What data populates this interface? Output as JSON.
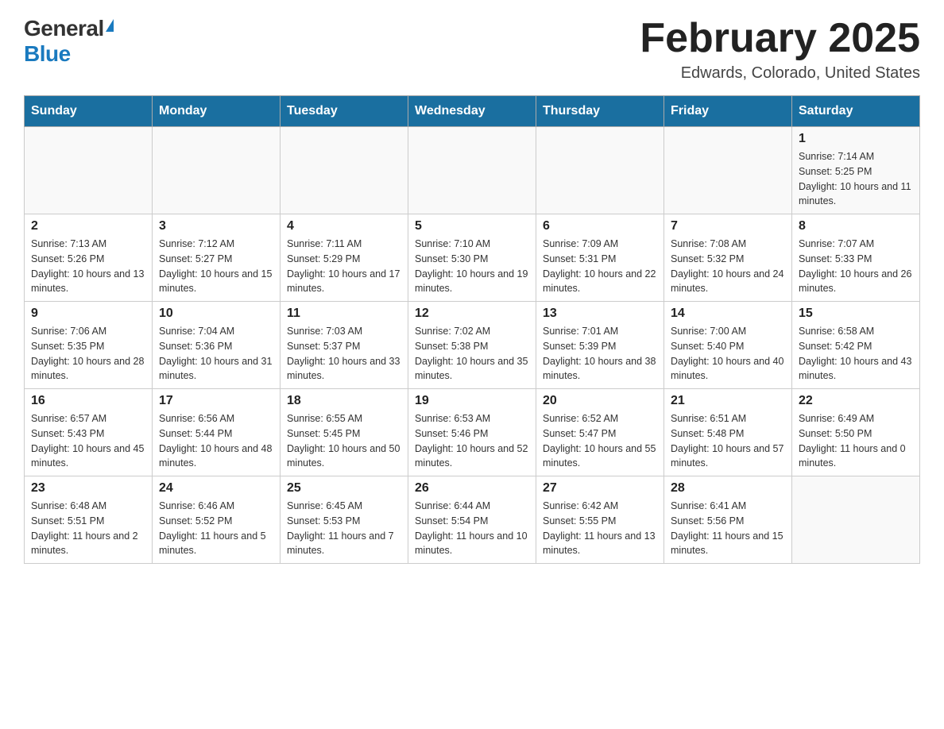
{
  "logo": {
    "general": "General",
    "blue": "Blue"
  },
  "title": "February 2025",
  "location": "Edwards, Colorado, United States",
  "days_of_week": [
    "Sunday",
    "Monday",
    "Tuesday",
    "Wednesday",
    "Thursday",
    "Friday",
    "Saturday"
  ],
  "weeks": [
    [
      {
        "day": "",
        "info": ""
      },
      {
        "day": "",
        "info": ""
      },
      {
        "day": "",
        "info": ""
      },
      {
        "day": "",
        "info": ""
      },
      {
        "day": "",
        "info": ""
      },
      {
        "day": "",
        "info": ""
      },
      {
        "day": "1",
        "info": "Sunrise: 7:14 AM\nSunset: 5:25 PM\nDaylight: 10 hours and 11 minutes."
      }
    ],
    [
      {
        "day": "2",
        "info": "Sunrise: 7:13 AM\nSunset: 5:26 PM\nDaylight: 10 hours and 13 minutes."
      },
      {
        "day": "3",
        "info": "Sunrise: 7:12 AM\nSunset: 5:27 PM\nDaylight: 10 hours and 15 minutes."
      },
      {
        "day": "4",
        "info": "Sunrise: 7:11 AM\nSunset: 5:29 PM\nDaylight: 10 hours and 17 minutes."
      },
      {
        "day": "5",
        "info": "Sunrise: 7:10 AM\nSunset: 5:30 PM\nDaylight: 10 hours and 19 minutes."
      },
      {
        "day": "6",
        "info": "Sunrise: 7:09 AM\nSunset: 5:31 PM\nDaylight: 10 hours and 22 minutes."
      },
      {
        "day": "7",
        "info": "Sunrise: 7:08 AM\nSunset: 5:32 PM\nDaylight: 10 hours and 24 minutes."
      },
      {
        "day": "8",
        "info": "Sunrise: 7:07 AM\nSunset: 5:33 PM\nDaylight: 10 hours and 26 minutes."
      }
    ],
    [
      {
        "day": "9",
        "info": "Sunrise: 7:06 AM\nSunset: 5:35 PM\nDaylight: 10 hours and 28 minutes."
      },
      {
        "day": "10",
        "info": "Sunrise: 7:04 AM\nSunset: 5:36 PM\nDaylight: 10 hours and 31 minutes."
      },
      {
        "day": "11",
        "info": "Sunrise: 7:03 AM\nSunset: 5:37 PM\nDaylight: 10 hours and 33 minutes."
      },
      {
        "day": "12",
        "info": "Sunrise: 7:02 AM\nSunset: 5:38 PM\nDaylight: 10 hours and 35 minutes."
      },
      {
        "day": "13",
        "info": "Sunrise: 7:01 AM\nSunset: 5:39 PM\nDaylight: 10 hours and 38 minutes."
      },
      {
        "day": "14",
        "info": "Sunrise: 7:00 AM\nSunset: 5:40 PM\nDaylight: 10 hours and 40 minutes."
      },
      {
        "day": "15",
        "info": "Sunrise: 6:58 AM\nSunset: 5:42 PM\nDaylight: 10 hours and 43 minutes."
      }
    ],
    [
      {
        "day": "16",
        "info": "Sunrise: 6:57 AM\nSunset: 5:43 PM\nDaylight: 10 hours and 45 minutes."
      },
      {
        "day": "17",
        "info": "Sunrise: 6:56 AM\nSunset: 5:44 PM\nDaylight: 10 hours and 48 minutes."
      },
      {
        "day": "18",
        "info": "Sunrise: 6:55 AM\nSunset: 5:45 PM\nDaylight: 10 hours and 50 minutes."
      },
      {
        "day": "19",
        "info": "Sunrise: 6:53 AM\nSunset: 5:46 PM\nDaylight: 10 hours and 52 minutes."
      },
      {
        "day": "20",
        "info": "Sunrise: 6:52 AM\nSunset: 5:47 PM\nDaylight: 10 hours and 55 minutes."
      },
      {
        "day": "21",
        "info": "Sunrise: 6:51 AM\nSunset: 5:48 PM\nDaylight: 10 hours and 57 minutes."
      },
      {
        "day": "22",
        "info": "Sunrise: 6:49 AM\nSunset: 5:50 PM\nDaylight: 11 hours and 0 minutes."
      }
    ],
    [
      {
        "day": "23",
        "info": "Sunrise: 6:48 AM\nSunset: 5:51 PM\nDaylight: 11 hours and 2 minutes."
      },
      {
        "day": "24",
        "info": "Sunrise: 6:46 AM\nSunset: 5:52 PM\nDaylight: 11 hours and 5 minutes."
      },
      {
        "day": "25",
        "info": "Sunrise: 6:45 AM\nSunset: 5:53 PM\nDaylight: 11 hours and 7 minutes."
      },
      {
        "day": "26",
        "info": "Sunrise: 6:44 AM\nSunset: 5:54 PM\nDaylight: 11 hours and 10 minutes."
      },
      {
        "day": "27",
        "info": "Sunrise: 6:42 AM\nSunset: 5:55 PM\nDaylight: 11 hours and 13 minutes."
      },
      {
        "day": "28",
        "info": "Sunrise: 6:41 AM\nSunset: 5:56 PM\nDaylight: 11 hours and 15 minutes."
      },
      {
        "day": "",
        "info": ""
      }
    ]
  ]
}
